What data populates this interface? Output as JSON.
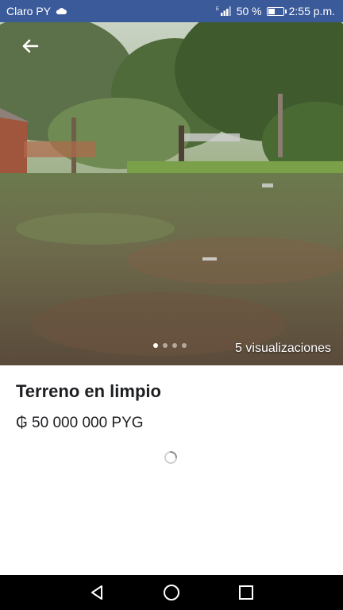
{
  "status_bar": {
    "carrier": "Claro PY",
    "battery_percent": "50 %",
    "battery_level": 0.5,
    "time": "2:55 p.m."
  },
  "listing": {
    "photo_count": 4,
    "current_photo_index": 1,
    "views": "5 visualizaciones",
    "title": "Terreno en limpio",
    "price": "₲ 50 000 000 PYG"
  },
  "colors": {
    "status_bar_bg": "#3b5a9a",
    "nav_bar_bg": "#000000",
    "text_primary": "#1c1e21"
  },
  "icons": {
    "back": "arrow-left-icon",
    "cloud": "cloud-icon",
    "signal": "signal-icon",
    "battery": "battery-icon",
    "nav_back": "triangle-back-icon",
    "nav_home": "circle-home-icon",
    "nav_recents": "square-recents-icon"
  }
}
